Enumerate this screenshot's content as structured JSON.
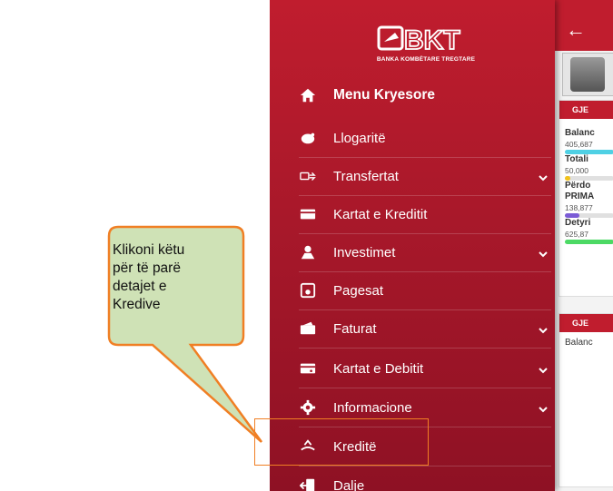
{
  "logo": {
    "brand": "BKT",
    "tagline": "BANKA KOMBËTARE TREGTARE"
  },
  "menu": {
    "items": [
      {
        "label": "Menu Kryesore",
        "icon": "home-icon"
      },
      {
        "label": "Llogaritë",
        "icon": "piggy-bank-icon"
      },
      {
        "label": "Transfertat",
        "icon": "transfer-icon",
        "expandable": true
      },
      {
        "label": "Kartat e Kreditit",
        "icon": "credit-card-icon"
      },
      {
        "label": "Investimet",
        "icon": "investment-icon",
        "expandable": true
      },
      {
        "label": "Pagesat",
        "icon": "payment-icon"
      },
      {
        "label": "Faturat",
        "icon": "bills-icon",
        "expandable": true
      },
      {
        "label": "Kartat e Debitit",
        "icon": "debit-card-icon",
        "expandable": true
      },
      {
        "label": "Informacione",
        "icon": "gear-icon",
        "expandable": true
      },
      {
        "label": "Kreditë",
        "icon": "loan-hand-icon"
      },
      {
        "label": "Dalje",
        "icon": "logout-icon"
      }
    ]
  },
  "app": {
    "back": "←",
    "card1": {
      "header": "GJE",
      "balance_label": "Balanc",
      "balance_value": "405,687",
      "total_label": "Totali",
      "total_value": "50,000",
      "used_label": "Përdo",
      "used_label2": "PRIMA",
      "used_value": "138,877",
      "debt_label": "Detyri",
      "debt_value": "625,87"
    },
    "card2": {
      "header": "GJE",
      "balance_label": "Balanc"
    }
  },
  "callout": {
    "line1": "Klikoni këtu",
    "line2": "për të parë",
    "line3": "detajet e",
    "line4": "Kredive"
  },
  "colors": {
    "brand_red": "#c01d2e",
    "callout_fill": "#cfe2b6",
    "callout_border": "#f07f24"
  }
}
